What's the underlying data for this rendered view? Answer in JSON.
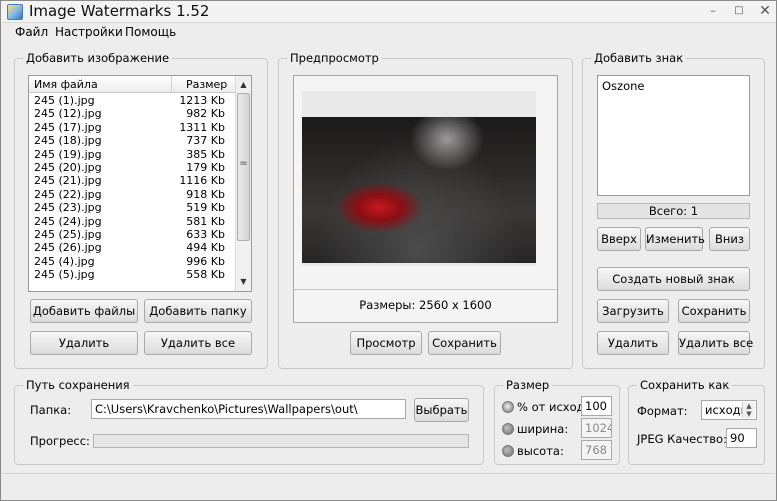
{
  "window": {
    "title": "Image Watermarks 1.52",
    "minimize": "–",
    "maximize": "□",
    "close": "✕"
  },
  "menu": {
    "file": "Файл",
    "settings": "Настройки",
    "help": "Помощь"
  },
  "add_image": {
    "group_title": "Добавить изображение",
    "col_name": "Имя файла",
    "col_size": "Размер",
    "files": [
      {
        "name": "245 (1).jpg",
        "size": "1213 Kb"
      },
      {
        "name": "245 (12).jpg",
        "size": "982 Kb"
      },
      {
        "name": "245 (17).jpg",
        "size": "1311 Kb"
      },
      {
        "name": "245 (18).jpg",
        "size": "737 Kb"
      },
      {
        "name": "245 (19).jpg",
        "size": "385 Kb"
      },
      {
        "name": "245 (20).jpg",
        "size": "179 Kb"
      },
      {
        "name": "245 (21).jpg",
        "size": "1116 Kb"
      },
      {
        "name": "245 (22).jpg",
        "size": "918 Kb"
      },
      {
        "name": "245 (23).jpg",
        "size": "519 Kb"
      },
      {
        "name": "245 (24).jpg",
        "size": "581 Kb"
      },
      {
        "name": "245 (25).jpg",
        "size": "633 Kb"
      },
      {
        "name": "245 (26).jpg",
        "size": "494 Kb"
      },
      {
        "name": "245 (4).jpg",
        "size": "996 Kb"
      },
      {
        "name": "245 (5).jpg",
        "size": "558 Kb"
      }
    ],
    "add_files_button": "Добавить файлы",
    "add_folder_button": "Добавить папку",
    "delete_button": "Удалить",
    "delete_all_button": "Удалить все"
  },
  "preview": {
    "group_title": "Предпросмотр",
    "dimensions": "Размеры: 2560 x 1600",
    "view_button": "Просмотр",
    "save_button": "Сохранить"
  },
  "add_mark": {
    "group_title": "Добавить знак",
    "items": [
      "Oszone"
    ],
    "total": "Всего: 1",
    "up_button": "Вверх",
    "edit_button": "Изменить",
    "down_button": "Вниз",
    "create_button": "Создать новый знак",
    "load_button": "Загрузить",
    "save_button": "Сохранить",
    "delete_button": "Удалить",
    "delete_all_button": "Удалить все"
  },
  "save_path": {
    "group_title": "Путь сохранения",
    "folder_label": "Папка:",
    "folder_value": "C:\\Users\\Kravchenko\\Pictures\\Wallpapers\\out\\",
    "browse_button": "Выбрать",
    "progress_label": "Прогресс:",
    "progress": 0
  },
  "size": {
    "group_title": "Размер",
    "percent_label": "% от исход:",
    "percent_value": "100",
    "width_label": "ширина:",
    "width_value": "1024",
    "height_label": "высота:",
    "height_value": "768",
    "selected": "percent"
  },
  "save_as": {
    "group_title": "Сохранить как",
    "format_label": "Формат:",
    "format_value": "исходн",
    "jpeg_quality_label": "JPEG Качество:",
    "jpeg_quality_value": "90"
  }
}
